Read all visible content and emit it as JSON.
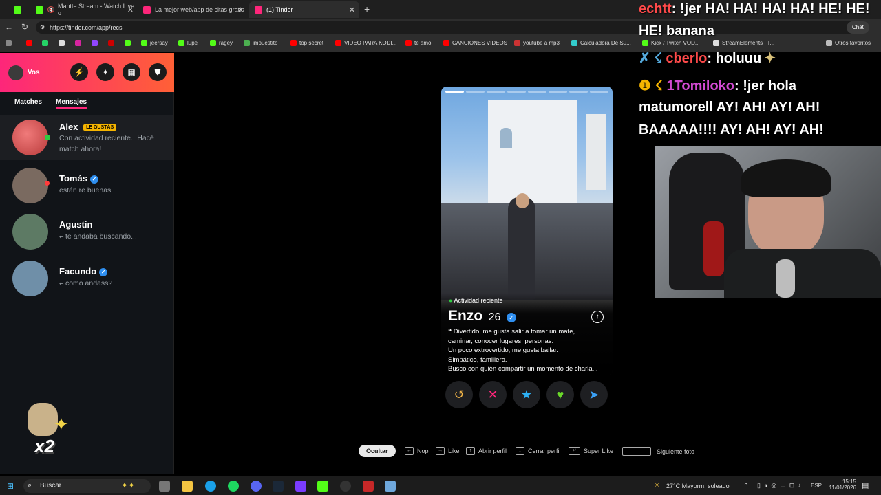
{
  "tabs": [
    {
      "label": "",
      "color": "#53fc18"
    },
    {
      "label": "Mantte Stream - Watch Live o",
      "color": "#53fc18"
    },
    {
      "label": "La mejor web/app de citas gratis",
      "color": "#fd267a"
    },
    {
      "label": "(1) Tinder",
      "color": "#fd267a"
    }
  ],
  "url": "https://tinder.com/app/recs",
  "bookmarks": [
    "jeersay",
    "lupe",
    "ragey",
    "impuestito",
    "top secret",
    "VIDEO PARA KODI...",
    "te amo",
    "CANCIONES VIDEOS",
    "youtube a mp3",
    "Calculadora De Su...",
    "Kick / Twitch VOD...",
    "StreamElements | T...",
    "Otros favoritos"
  ],
  "profile_label": "Vos",
  "subtabs": {
    "matches": "Matches",
    "messages": "Mensajes"
  },
  "matches": [
    {
      "name": "Alex",
      "badge": "LE GUSTÁS",
      "msg1": "Con actividad reciente. ¡Hacé",
      "msg2": "match ahora!",
      "color": "#d94a4a",
      "verified": false
    },
    {
      "name": "Tomás",
      "badge": "",
      "msg1": "están re buenas",
      "msg2": "",
      "color": "#7a6a60",
      "verified": true
    },
    {
      "name": "Agustin",
      "badge": "",
      "msg1": "te andaba buscando...",
      "msg2": "",
      "color": "#5d7a64",
      "verified": false
    },
    {
      "name": "Facundo",
      "badge": "",
      "msg1": "como andass?",
      "msg2": "",
      "color": "#6f8fa8",
      "verified": true
    }
  ],
  "card": {
    "activity": "Actividad reciente",
    "name": "Enzo",
    "age": "26",
    "bio": [
      "Divertido, me gusta salir a tomar un mate,",
      "caminar, conocer lugares, personas.",
      "Un poco extrovertido, me gusta bailar.",
      "Simpático, familiero.",
      "Busco con quién compartir un momento de charla..."
    ]
  },
  "actions": [
    {
      "icon": "undo-icon",
      "glyph": "↺",
      "color": "#f5b748"
    },
    {
      "icon": "nope-icon",
      "glyph": "✕",
      "color": "#fd267a"
    },
    {
      "icon": "super-like-icon",
      "glyph": "★",
      "color": "#2db1f5"
    },
    {
      "icon": "like-icon",
      "glyph": "♥",
      "color": "#6ad82a"
    },
    {
      "icon": "boost-icon",
      "glyph": "➤",
      "color": "#3aa0f5"
    }
  ],
  "hints": {
    "hide": "Ocultar",
    "nope": "Nop",
    "like": "Like",
    "open": "Abrir perfil",
    "close": "Cerrar perfil",
    "super": "Super Like",
    "next": "Siguiente foto"
  },
  "chat": [
    {
      "user": "echtt",
      "text": ": !jer HA! HA! HA! HA! HE! HE!",
      "color": "#ff4a4a"
    },
    {
      "user": "",
      "text": "HE! banana",
      "color": "#fff"
    },
    {
      "user": "cberlo",
      "text": ": holuuu",
      "color": "#ff4a4a"
    },
    {
      "user": "1Tomiloko",
      "text": ": !jer hola",
      "color": "#d24ad2"
    },
    {
      "user": "",
      "text": "matumorell AY! AH! AY! AH!",
      "color": "#fff"
    },
    {
      "user": "",
      "text": "BAAAAA!!!! AY! AH! AY! AH!",
      "color": "#fff"
    }
  ],
  "sticker_text": "x2",
  "taskbar": {
    "search": "Buscar",
    "weather": "27°C  Mayorm. soleado",
    "lang": "ESP",
    "time": "15:15",
    "date": "11/01/2026"
  },
  "chat_btn": "Chat"
}
